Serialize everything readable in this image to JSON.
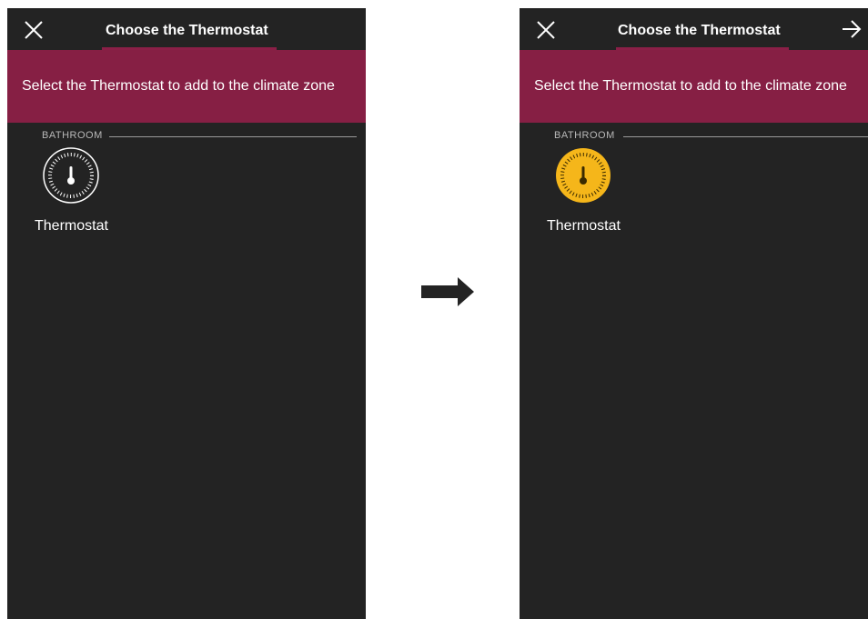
{
  "screens": [
    {
      "id": "before",
      "header": {
        "title": "Choose the Thermostat",
        "close_icon": "close-icon",
        "show_next": false
      },
      "banner": {
        "text": "Select the Thermostat to add to the climate zone"
      },
      "section": {
        "label": "BATHROOM"
      },
      "device": {
        "label": "Thermostat",
        "icon": "thermostat-icon",
        "selected": false
      }
    },
    {
      "id": "after",
      "header": {
        "title": "Choose the Thermostat",
        "close_icon": "close-icon",
        "show_next": true,
        "next_icon": "arrow-right-icon"
      },
      "banner": {
        "text": "Select the Thermostat to add to the climate zone"
      },
      "section": {
        "label": "BATHROOM"
      },
      "device": {
        "label": "Thermostat",
        "icon": "thermostat-icon",
        "selected": true
      }
    }
  ],
  "transition_icon": "arrow-right-icon",
  "colors": {
    "background": "#232323",
    "accent": "#861f44",
    "selected": "#f5b61a",
    "text": "#ffffff"
  }
}
